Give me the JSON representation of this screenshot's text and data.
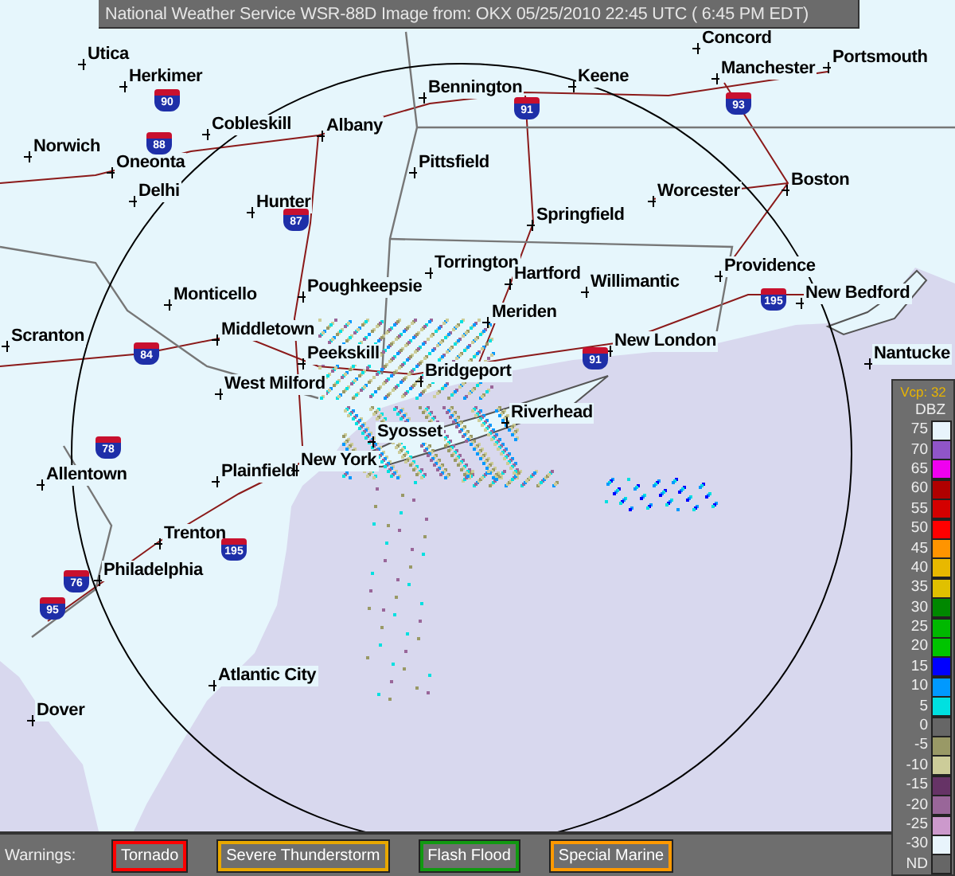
{
  "title": "National Weather Service WSR-88D Image from: OKX 05/25/2010 22:45 UTC ( 6:45 PM EDT)",
  "map": {
    "cities": [
      "Utica",
      "Herkimer",
      "Cobleskill",
      "Albany",
      "Norwich",
      "Oneonta",
      "Delhi",
      "Hunter",
      "Bennington",
      "Keene",
      "Manchester",
      "Portsmouth",
      "Concord",
      "Pittsfield",
      "Worcester",
      "Boston",
      "Springfield",
      "Torrington",
      "Hartford",
      "Willimantic",
      "Providence",
      "New Bedford",
      "Meriden",
      "New London",
      "Nantucke",
      "Monticello",
      "Poughkeepsie",
      "Middletown",
      "Scranton",
      "Peekskill",
      "West Milford",
      "Bridgeport",
      "Syosset",
      "Riverhead",
      "Allentown",
      "Plainfield",
      "New York",
      "Trenton",
      "Philadelphia",
      "Atlantic City",
      "Dover"
    ],
    "shields": [
      "90",
      "88",
      "87",
      "84",
      "91",
      "93",
      "91",
      "195",
      "78",
      "195",
      "76",
      "95"
    ]
  },
  "legend": {
    "mode": "Vcp: 32",
    "unit": "DBZ",
    "scale": [
      {
        "value": "75",
        "color": "#e8f4fc"
      },
      {
        "value": "70",
        "color": "#9055c8"
      },
      {
        "value": "65",
        "color": "#f000f0"
      },
      {
        "value": "60",
        "color": "#b00000"
      },
      {
        "value": "55",
        "color": "#d40000"
      },
      {
        "value": "50",
        "color": "#ff0000"
      },
      {
        "value": "45",
        "color": "#ff9400"
      },
      {
        "value": "40",
        "color": "#e8b800"
      },
      {
        "value": "35",
        "color": "#e0c000"
      },
      {
        "value": "30",
        "color": "#008800"
      },
      {
        "value": "25",
        "color": "#00b800"
      },
      {
        "value": "20",
        "color": "#00c400"
      },
      {
        "value": "15",
        "color": "#0000ff"
      },
      {
        "value": "10",
        "color": "#0099ff"
      },
      {
        "value": "5",
        "color": "#00e0e0"
      },
      {
        "value": "0",
        "color": "#666666"
      },
      {
        "value": "-5",
        "color": "#999966"
      },
      {
        "value": "-10",
        "color": "#cccc99"
      },
      {
        "value": "-15",
        "color": "#663366"
      },
      {
        "value": "-20",
        "color": "#996699"
      },
      {
        "value": "-25",
        "color": "#cc99cc"
      },
      {
        "value": "-30",
        "color": "#e8f4fc"
      },
      {
        "value": "ND",
        "color": "#666666"
      }
    ]
  },
  "warnings": {
    "label": "Warnings:",
    "items": [
      {
        "label": "Tornado",
        "color": "#ff0000"
      },
      {
        "label": "Severe Thunderstorm",
        "color": "#e8a800"
      },
      {
        "label": "Flash Flood",
        "color": "#119911"
      },
      {
        "label": "Special Marine",
        "color": "#ff9900"
      }
    ]
  }
}
